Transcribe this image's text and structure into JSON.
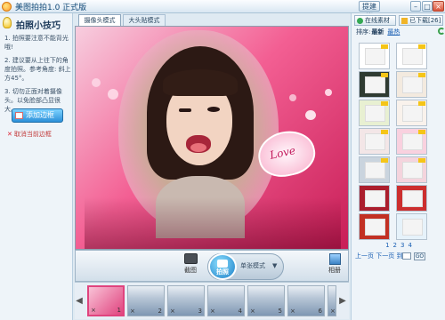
{
  "window": {
    "title": "美图拍拍1.0 正式版",
    "feedback_label": "提建议",
    "min_label": "–",
    "max_label": "□",
    "close_label": "×"
  },
  "tips": {
    "title": "拍照小技巧",
    "items": [
      "1. 拍照要注意不能背光哦!",
      "2. 建议要从上往下的角度拍照。参考角度: 斜上方45°。",
      "3. 切勿正面对着摄像头。以免脸部凸显很大。"
    ]
  },
  "frame_actions": {
    "add_label": "添加边框",
    "cancel_label": "取消当前边框"
  },
  "camera_tabs": [
    "摄像头模式",
    "大头贴模式"
  ],
  "photo": {
    "overlay_text": "Love"
  },
  "controls": {
    "album_label": "截图",
    "shoot_label": "拍照",
    "mode_label": "单张模式",
    "mode_arrow": "▼",
    "gallery_label": "相册"
  },
  "filmstrip": {
    "prev": "◀",
    "next": "▶",
    "thumbs": [
      {
        "n": "1",
        "x": "×"
      },
      {
        "n": "2",
        "x": "×"
      },
      {
        "n": "3",
        "x": "×"
      },
      {
        "n": "4",
        "x": "×"
      },
      {
        "n": "5",
        "x": "×"
      },
      {
        "n": "6",
        "x": "×"
      },
      {
        "n": "7",
        "x": "×"
      }
    ]
  },
  "right_panel": {
    "tab_online": "在线素材",
    "tab_downloaded": "已下载[26]",
    "sort_label": "排序:",
    "sort_newest": "最新",
    "sort_hot": "最热",
    "frame_colors": [
      "#ffffff",
      "#ffffff",
      "#2f3b32",
      "#f3eadf",
      "#e8f0d2",
      "#f9f2ec",
      "#f3e6e7",
      "#f9d1df",
      "#cad4de",
      "#f4d4dd",
      "#ab1e2d",
      "#cc2e2e",
      "#c23023",
      "#e6f2fa"
    ],
    "pages": [
      "1",
      "2",
      "3",
      "4"
    ],
    "prev_page": "上一页",
    "next_page": "下一页",
    "jump_label": "到",
    "go_label": "GO"
  }
}
